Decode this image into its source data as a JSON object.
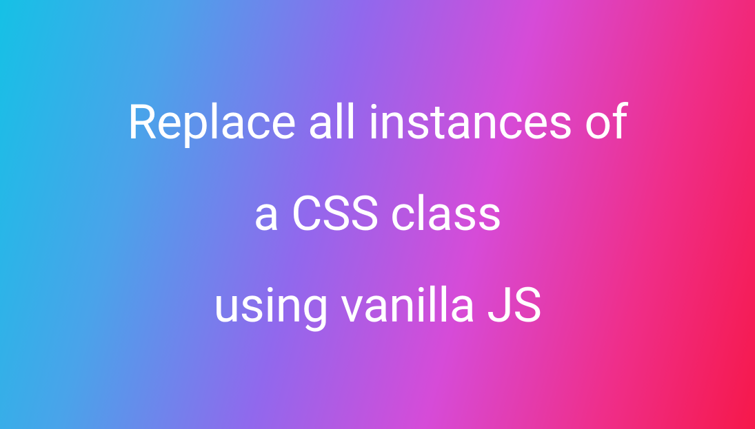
{
  "hero": {
    "headline_line1": "Replace all instances of",
    "headline_line2": "a CSS class",
    "headline_line3": "using vanilla JS"
  },
  "colors": {
    "gradient_start": "#15c1e6",
    "gradient_mid1": "#4aa3ea",
    "gradient_mid2": "#9168ed",
    "gradient_mid3": "#d64bd8",
    "gradient_mid4": "#ef2e8a",
    "gradient_end": "#f6184a",
    "text": "#ffffff"
  }
}
